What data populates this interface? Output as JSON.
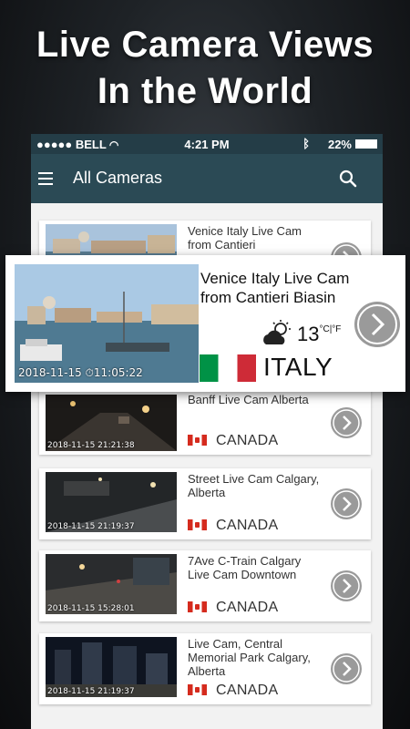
{
  "promo": {
    "headline_line1": "Live Camera Views",
    "headline_line2": "In the World"
  },
  "status_bar": {
    "carrier": "●●●●● BELL",
    "time": "4:21 PM",
    "battery": "22%"
  },
  "app_bar": {
    "title": "All Cameras",
    "menu_icon": "hamburger-menu-icon",
    "search_icon": "search-icon"
  },
  "featured": {
    "title": "Venice Italy Live Cam from Cantieri Biasin",
    "timestamp": "2018-11-15 ⏱11:05:22",
    "temperature": "13",
    "temperature_unit": "°C|°F",
    "weather_icon": "partly-cloudy-icon",
    "country": "ITALY",
    "flag": "italy-flag"
  },
  "cameras": [
    {
      "title": "Venice Italy Live Cam from Cantieri",
      "timestamp": "",
      "country": ""
    },
    {
      "title": "Banff Live Cam Alberta",
      "timestamp": "2018-11-15 21:21:38",
      "country": "CANADA"
    },
    {
      "title": "Street Live Cam Calgary, Alberta",
      "timestamp": "2018-11-15 21:19:37",
      "country": "CANADA"
    },
    {
      "title": "7Ave C-Train Calgary Live Cam Downtown",
      "timestamp": "2018-11-15 15:28:01",
      "country": "CANADA"
    },
    {
      "title": "Live Cam, Central Memorial Park Calgary, Alberta",
      "timestamp": "2018-11-15 21:19:37",
      "country": "CANADA"
    }
  ],
  "colors": {
    "app_bar": "#2b4a55",
    "status_bar": "#243d47",
    "arrow_button": "#9a9a9a"
  }
}
